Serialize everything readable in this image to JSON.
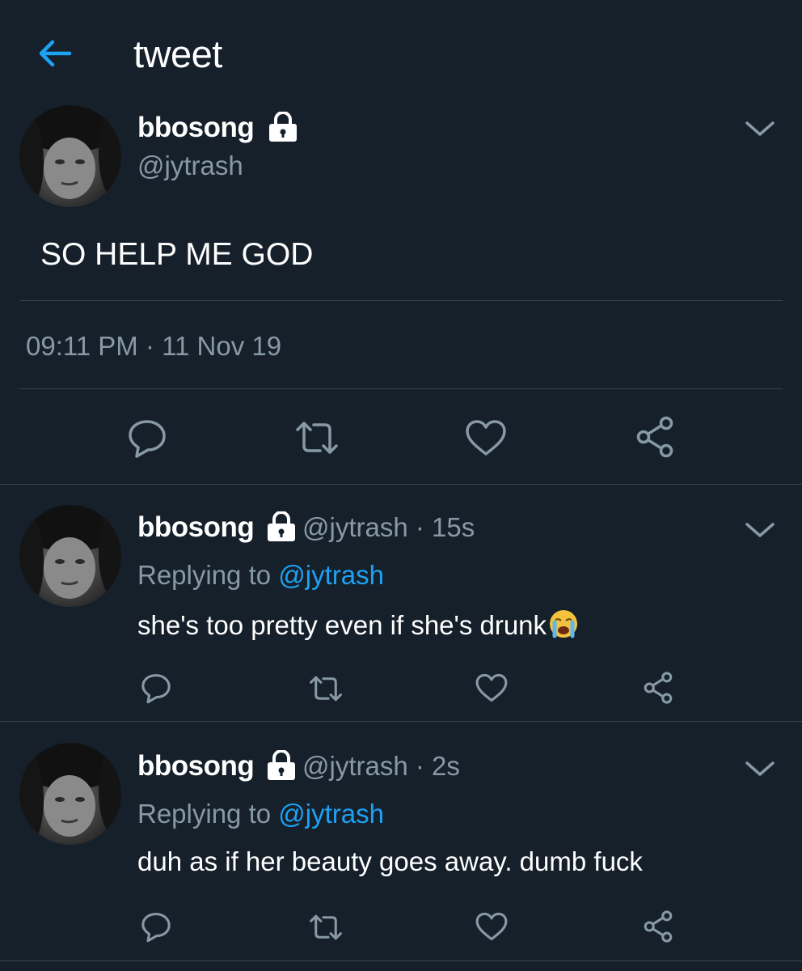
{
  "header": {
    "title": "tweet",
    "back_icon": "arrow-left-icon",
    "accent": "#1da1f2"
  },
  "main_tweet": {
    "name": "bbosong",
    "handle": "@jytrash",
    "text": "SO HELP ME GOD",
    "timestamp": "09:11 PM · 11 Nov 19"
  },
  "replies": [
    {
      "name": "bbosong",
      "meta": "@jytrash · 15s",
      "replying_prefix": "Replying to",
      "replying_to": "@jytrash",
      "text": "she's too pretty even if she's drunk",
      "emoji": "crying-face-emoji"
    },
    {
      "name": "bbosong",
      "meta": "@jytrash · 2s",
      "replying_prefix": "Replying to",
      "replying_to": "@jytrash",
      "text": "duh as if her beauty goes away. dumb fuck"
    }
  ],
  "colors": {
    "background": "#15202b",
    "secondary_text": "#8899a6",
    "divider": "#38444d",
    "icon": "#8899a6"
  }
}
